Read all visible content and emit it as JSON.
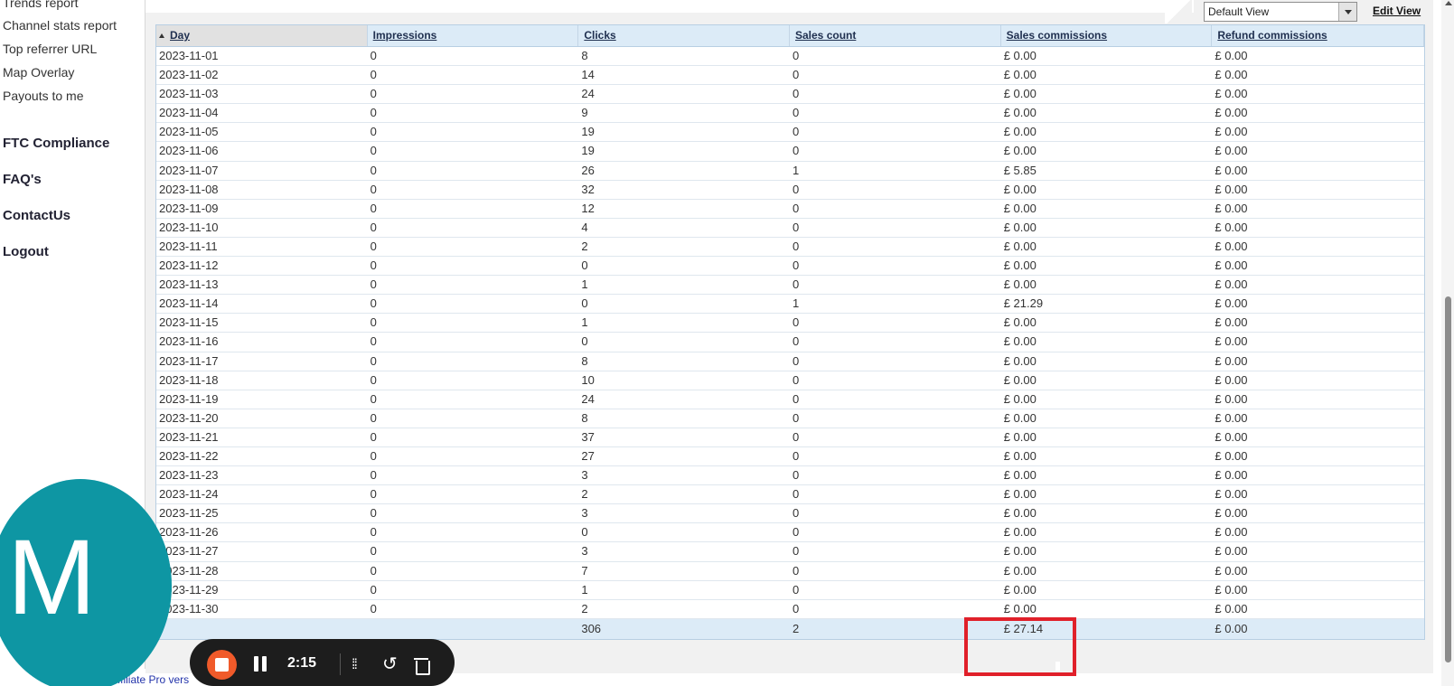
{
  "sidebar": {
    "links": [
      "Trends report",
      "Channel stats report",
      "Top referrer URL",
      "Map Overlay",
      "Payouts to me"
    ],
    "sections": [
      "FTC Compliance",
      "FAQ's",
      "ContactUs",
      "Logout"
    ]
  },
  "toolbar": {
    "view_select": "Default View",
    "edit_view": "Edit View"
  },
  "table": {
    "columns": [
      "Day",
      "Impressions",
      "Clicks",
      "Sales count",
      "Sales commissions",
      "Refund commissions"
    ],
    "rows": [
      [
        "2023-11-01",
        "0",
        "8",
        "0",
        "£ 0.00",
        "£ 0.00"
      ],
      [
        "2023-11-02",
        "0",
        "14",
        "0",
        "£ 0.00",
        "£ 0.00"
      ],
      [
        "2023-11-03",
        "0",
        "24",
        "0",
        "£ 0.00",
        "£ 0.00"
      ],
      [
        "2023-11-04",
        "0",
        "9",
        "0",
        "£ 0.00",
        "£ 0.00"
      ],
      [
        "2023-11-05",
        "0",
        "19",
        "0",
        "£ 0.00",
        "£ 0.00"
      ],
      [
        "2023-11-06",
        "0",
        "19",
        "0",
        "£ 0.00",
        "£ 0.00"
      ],
      [
        "2023-11-07",
        "0",
        "26",
        "1",
        "£ 5.85",
        "£ 0.00"
      ],
      [
        "2023-11-08",
        "0",
        "32",
        "0",
        "£ 0.00",
        "£ 0.00"
      ],
      [
        "2023-11-09",
        "0",
        "12",
        "0",
        "£ 0.00",
        "£ 0.00"
      ],
      [
        "2023-11-10",
        "0",
        "4",
        "0",
        "£ 0.00",
        "£ 0.00"
      ],
      [
        "2023-11-11",
        "0",
        "2",
        "0",
        "£ 0.00",
        "£ 0.00"
      ],
      [
        "2023-11-12",
        "0",
        "0",
        "0",
        "£ 0.00",
        "£ 0.00"
      ],
      [
        "2023-11-13",
        "0",
        "1",
        "0",
        "£ 0.00",
        "£ 0.00"
      ],
      [
        "2023-11-14",
        "0",
        "0",
        "1",
        "£ 21.29",
        "£ 0.00"
      ],
      [
        "2023-11-15",
        "0",
        "1",
        "0",
        "£ 0.00",
        "£ 0.00"
      ],
      [
        "2023-11-16",
        "0",
        "0",
        "0",
        "£ 0.00",
        "£ 0.00"
      ],
      [
        "2023-11-17",
        "0",
        "8",
        "0",
        "£ 0.00",
        "£ 0.00"
      ],
      [
        "2023-11-18",
        "0",
        "10",
        "0",
        "£ 0.00",
        "£ 0.00"
      ],
      [
        "2023-11-19",
        "0",
        "24",
        "0",
        "£ 0.00",
        "£ 0.00"
      ],
      [
        "2023-11-20",
        "0",
        "8",
        "0",
        "£ 0.00",
        "£ 0.00"
      ],
      [
        "2023-11-21",
        "0",
        "37",
        "0",
        "£ 0.00",
        "£ 0.00"
      ],
      [
        "2023-11-22",
        "0",
        "27",
        "0",
        "£ 0.00",
        "£ 0.00"
      ],
      [
        "2023-11-23",
        "0",
        "3",
        "0",
        "£ 0.00",
        "£ 0.00"
      ],
      [
        "2023-11-24",
        "0",
        "2",
        "0",
        "£ 0.00",
        "£ 0.00"
      ],
      [
        "2023-11-25",
        "0",
        "3",
        "0",
        "£ 0.00",
        "£ 0.00"
      ],
      [
        "2023-11-26",
        "0",
        "0",
        "0",
        "£ 0.00",
        "£ 0.00"
      ],
      [
        "2023-11-27",
        "0",
        "3",
        "0",
        "£ 0.00",
        "£ 0.00"
      ],
      [
        "2023-11-28",
        "0",
        "7",
        "0",
        "£ 0.00",
        "£ 0.00"
      ],
      [
        "2023-11-29",
        "0",
        "1",
        "0",
        "£ 0.00",
        "£ 0.00"
      ],
      [
        "2023-11-30",
        "0",
        "2",
        "0",
        "£ 0.00",
        "£ 0.00"
      ]
    ],
    "totals": [
      "",
      "",
      "306",
      "2",
      "£ 27.14",
      "£ 0.00"
    ]
  },
  "footer": {
    "text": "Affiliate Pro vers"
  },
  "recorder": {
    "avatar_letter": "M",
    "time": "2:15",
    "colors": {
      "avatar": "#0e96a3",
      "stop": "#f05a2a",
      "bar": "#1d1d1d"
    }
  },
  "highlight": {
    "color": "#e0202a"
  }
}
